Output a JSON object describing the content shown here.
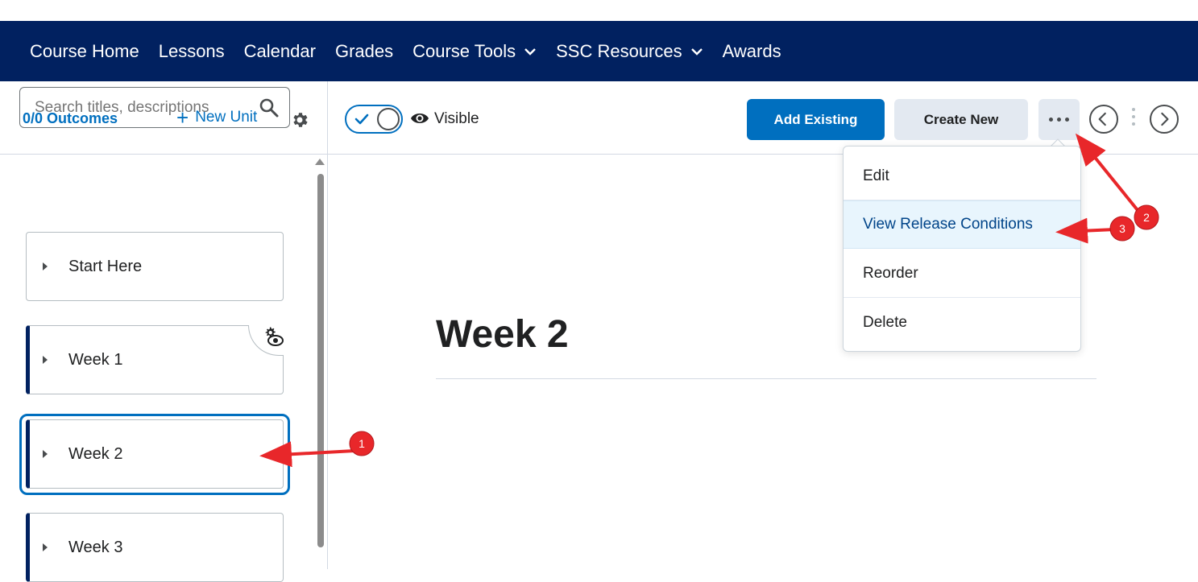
{
  "nav": {
    "items": [
      {
        "label": "Course Home"
      },
      {
        "label": "Lessons"
      },
      {
        "label": "Calendar"
      },
      {
        "label": "Grades"
      },
      {
        "label": "Course Tools",
        "dropdown": true
      },
      {
        "label": "SSC Resources",
        "dropdown": true
      },
      {
        "label": "Awards"
      }
    ]
  },
  "sidebar": {
    "outcomes_label": "0/0 Outcomes",
    "new_unit_label": "New Unit",
    "search_placeholder": "Search titles, descriptions",
    "units": [
      {
        "label": "Start Here"
      },
      {
        "label": "Week 1"
      },
      {
        "label": "Week 2"
      },
      {
        "label": "Week 3"
      }
    ]
  },
  "toolbar": {
    "visibility_label": "Visible",
    "add_existing_label": "Add Existing",
    "create_new_label": "Create New"
  },
  "main": {
    "title": "Week 2"
  },
  "menu": {
    "items": [
      {
        "label": "Edit"
      },
      {
        "label": "View Release Conditions"
      },
      {
        "label": "Reorder"
      },
      {
        "label": "Delete"
      }
    ]
  },
  "annotations": {
    "badges": [
      "1",
      "2",
      "3"
    ]
  },
  "colors": {
    "nav_bg": "#012160",
    "primary": "#006fbf",
    "annotation": "#e8272a"
  }
}
